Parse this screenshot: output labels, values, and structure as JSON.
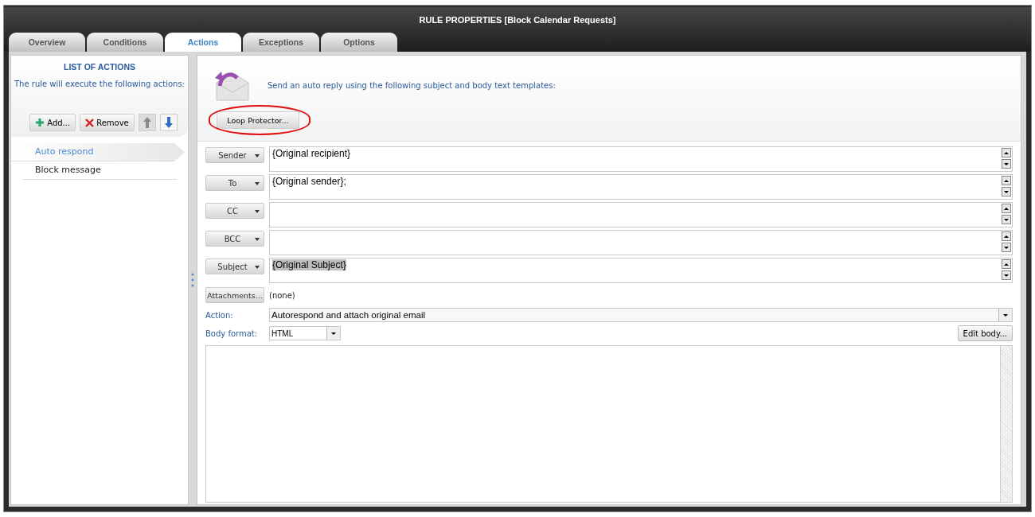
{
  "window": {
    "title": "RULE PROPERTIES [Block Calendar Requests]"
  },
  "tabs": [
    {
      "label": "Overview",
      "selected": false
    },
    {
      "label": "Conditions",
      "selected": false
    },
    {
      "label": "Actions",
      "selected": true
    },
    {
      "label": "Exceptions",
      "selected": false
    },
    {
      "label": "Options",
      "selected": false
    }
  ],
  "sidebar": {
    "heading": "LIST OF ACTIONS",
    "subtitle": "The rule will execute the following actions:",
    "buttons": [
      {
        "kind": "add",
        "label": "Add..."
      },
      {
        "kind": "remove",
        "label": "Remove"
      }
    ],
    "move_buttons": [
      {
        "kind": "up",
        "disabled": true
      },
      {
        "kind": "down",
        "disabled": false
      }
    ],
    "items": [
      {
        "label": "Auto respond",
        "selected": true
      },
      {
        "label": "Block message",
        "selected": false
      }
    ]
  },
  "main": {
    "description": "Send an auto reply using the following subject and body text templates:",
    "loop_protector_button": {
      "label": "Loop Protector...",
      "circled": true
    },
    "fields": [
      {
        "label": "Sender",
        "value": "{Original recipient}",
        "highlighted": false
      },
      {
        "label": "To",
        "value": "{Original sender};",
        "highlighted": false
      },
      {
        "label": "CC"
      },
      {
        "label": "BCC"
      },
      {
        "label": "Subject",
        "value": "{Original Subject}",
        "highlighted": true
      }
    ],
    "attachments": {
      "button": "Attachments...",
      "value": "(none)"
    },
    "action": {
      "label": "Action:",
      "value": "Autorespond and attach original email"
    },
    "body_format": {
      "label": "Body format:",
      "value": "HTML"
    },
    "edit_body_button": "Edit body..."
  }
}
